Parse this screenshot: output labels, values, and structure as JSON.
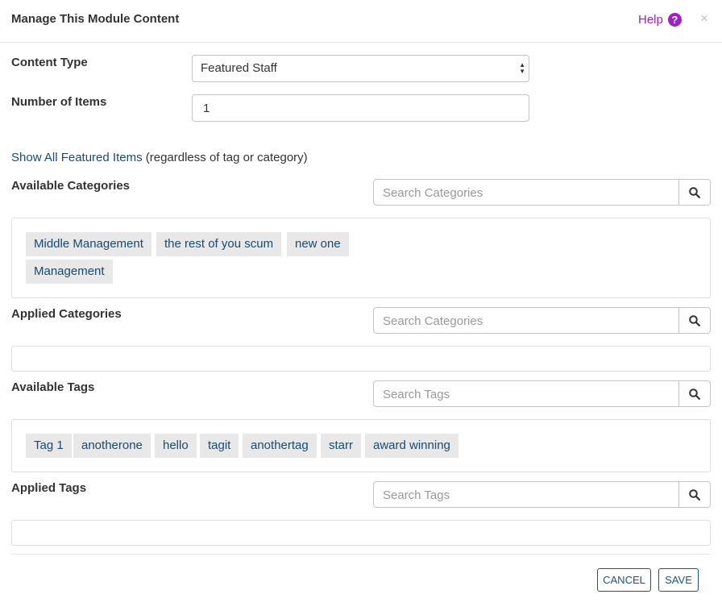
{
  "header": {
    "title": "Manage This Module Content",
    "help_label": "Help",
    "help_icon": "question-circle-icon",
    "close_label": "×",
    "accent_color": "#a020c8"
  },
  "form": {
    "content_type_label": "Content Type",
    "content_type_value": "Featured Staff",
    "number_label": "Number of Items",
    "number_value": "1",
    "show_all_link": "Show All Featured Items",
    "show_all_suffix": " (regardless of tag or category)"
  },
  "available_categories": {
    "label": "Available Categories",
    "search_placeholder": "Search Categories",
    "items": [
      "Middle Management",
      "the rest of you scum",
      "new one",
      "Management"
    ]
  },
  "applied_categories": {
    "label": "Applied Categories",
    "search_placeholder": "Search Categories",
    "items": []
  },
  "available_tags": {
    "label": "Available Tags",
    "search_placeholder": "Search Tags",
    "items": [
      "Tag 1",
      "anotherone",
      "hello",
      "tagit",
      "anothertag",
      "starr",
      "award winning"
    ]
  },
  "applied_tags": {
    "label": "Applied Tags",
    "search_placeholder": "Search Tags",
    "items": []
  },
  "footer": {
    "cancel_label": "CANCEL",
    "save_label": "SAVE",
    "button_color": "#23527c"
  }
}
